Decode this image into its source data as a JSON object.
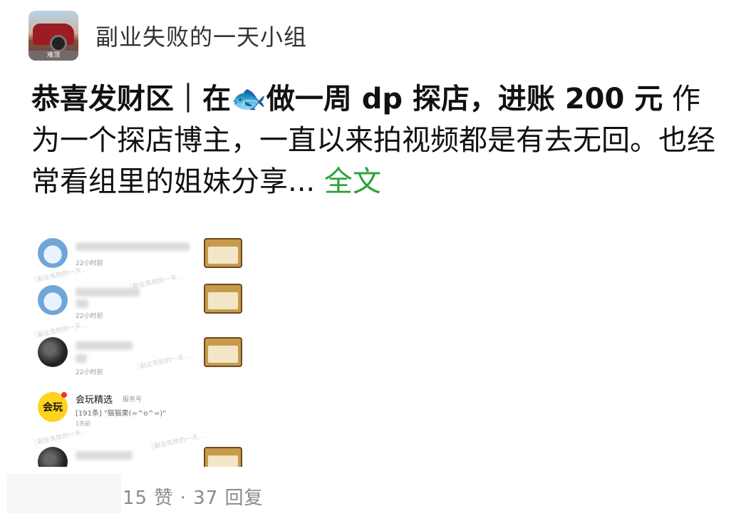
{
  "group": {
    "name": "副业失败的一天小组",
    "avatar_tag": "难顶"
  },
  "post": {
    "title": "恭喜发财区｜在",
    "fish": "🐟",
    "title_rest": "做一周 dp 探店，进账 200 元",
    "excerpt": " 作为一个探店博主，一直以来拍视频都是有去无回。也经常看组里的姐妹分享...",
    "full_link": " 全文"
  },
  "screenshot": {
    "items": [
      {
        "time": "22小时前"
      },
      {
        "time": "22小时前"
      },
      {
        "time": "22小时前"
      }
    ],
    "service": {
      "avatar_text": "会玩",
      "name": "会玩精选",
      "tag": "服务号",
      "message": "[191条] \"猫猫栗(=^o^=)\"",
      "time": "1天前"
    }
  },
  "stats": {
    "likes": "15 赞",
    "separator": " · ",
    "replies": "37 回复"
  },
  "colors": {
    "link_green": "#2ba33b",
    "stats_gray": "#8a8a8a"
  }
}
